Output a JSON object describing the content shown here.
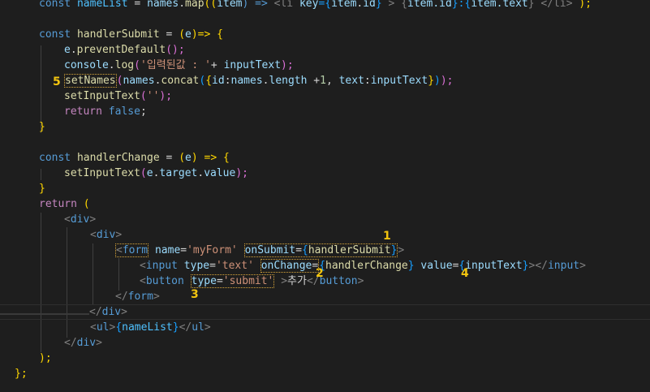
{
  "editor": {
    "lines": {
      "l0": {
        "a": "const",
        "b": "nameList",
        "c": " = ",
        "d": "names",
        "e": ".",
        "f": "map",
        "g": "((",
        "h": "item",
        "i": ") => ",
        "j": "<li",
        "k": " key",
        "l": "={",
        "m": "item",
        "n": ".",
        "o": "id",
        "p": "}",
        "q": " > {",
        "r": "item.id",
        "s": "}:{",
        "t": "item.text",
        "u": "} </li> ",
        "v": ");"
      },
      "l2": {
        "a": "const",
        "b": " handlerSubmit",
        "c": " = ",
        "d": "(",
        "e": "e",
        "f": ")=> ",
        "g": "{"
      },
      "l3": {
        "a": "e",
        "b": ".",
        "c": "preventDefault",
        "d": "();"
      },
      "l4": {
        "a": "console",
        "b": ".",
        "c": "log",
        "d": "(",
        "e": "'입력된값 : '",
        "f": "+ ",
        "g": "inputText",
        "h": ");"
      },
      "l5": {
        "a": "setNames",
        "b": "(",
        "c": "names",
        "d": ".",
        "e": "concat",
        "f": "(",
        "g": "{",
        "h": "id",
        "i": ":",
        "j": "names",
        "k": ".",
        "l": "length",
        "m": " +",
        "n": "1",
        "o": ", ",
        "p": "text",
        "q": ":",
        "r": "inputText",
        "s": "}",
        "t": ")",
        "u": ");"
      },
      "l6": {
        "a": "setInputText",
        "b": "(",
        "c": "''",
        "d": ");"
      },
      "l7": {
        "a": "return",
        "b": " false",
        "c": ";"
      },
      "l8": {
        "a": "}"
      },
      "l10": {
        "a": "const",
        "b": " handlerChange",
        "c": " = ",
        "d": "(",
        "e": "e",
        "f": ") => ",
        "g": "{"
      },
      "l11": {
        "a": "setInputText",
        "b": "(",
        "c": "e",
        "d": ".",
        "e": "target",
        "f": ".",
        "g": "value",
        "h": ");"
      },
      "l12": {
        "a": "}"
      },
      "l13": {
        "a": "return",
        "b": " ("
      },
      "l14": {
        "a": "<",
        "b": "div",
        "c": ">"
      },
      "l15": {
        "a": "<",
        "b": "div",
        "c": ">"
      },
      "l16": {
        "a": "<",
        "b": "form",
        "c": " name",
        "d": "=",
        "e": "'myForm'",
        "f": "onSubmit",
        "g": "=",
        "h": "{",
        "i": "handlerSubmit",
        "j": "}",
        "k": ">"
      },
      "l17": {
        "a": "<",
        "b": "input",
        "c": " type",
        "d": "=",
        "e": "'text'",
        "f": "onChange",
        "g": "=",
        "h": "{",
        "i": "handlerChange",
        "j": "}",
        "k": " value",
        "l": "=",
        "m": "{",
        "n": "inputText",
        "o": "}",
        "p": "></",
        "q": "input",
        "r": ">"
      },
      "l18": {
        "a": "<",
        "b": "button",
        "c": "type",
        "d": "=",
        "e": "'submit'",
        "f": ">",
        "g": "추가",
        "h": "</",
        "i": "button",
        "j": ">"
      },
      "l19": {
        "a": "</",
        "b": "form",
        "c": ">"
      },
      "l20": {
        "a": "</",
        "b": "div",
        "c": ">"
      },
      "l21": {
        "a": "<",
        "b": "ul",
        "c": ">",
        "d": "{",
        "e": "nameList",
        "f": "}",
        "g": "</",
        "h": "ul",
        "i": ">"
      },
      "l22": {
        "a": "</",
        "b": "div",
        "c": ">"
      },
      "l23": {
        "a": ");"
      },
      "l24": {
        "a": "};"
      }
    },
    "annotations": {
      "n1": "1",
      "n2": "2",
      "n3": "3",
      "n4": "4",
      "n5": "5"
    },
    "colors": {
      "background": "#1e1e1e",
      "keyword": "#569cd6",
      "function": "#dcdcaa",
      "variable": "#9cdcfe",
      "string": "#ce9178",
      "annotation": "#f2c40f"
    }
  }
}
